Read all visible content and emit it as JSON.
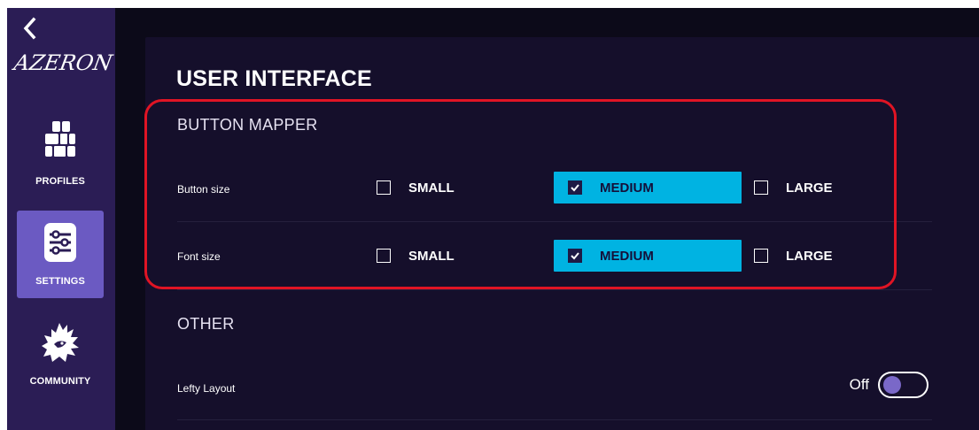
{
  "app": {
    "brand": "AZERON"
  },
  "sidebar": {
    "back_icon": "chevron-left-icon",
    "items": [
      {
        "label": "PROFILES",
        "icon": "grid-icon",
        "active": false
      },
      {
        "label": "SETTINGS",
        "icon": "sliders-icon",
        "active": true
      },
      {
        "label": "COMMUNITY",
        "icon": "dragon-icon",
        "active": false
      }
    ]
  },
  "main": {
    "title": "USER INTERFACE",
    "button_mapper": {
      "title": "BUTTON MAPPER",
      "rows": [
        {
          "label": "Button size",
          "options": [
            {
              "label": "SMALL",
              "checked": false
            },
            {
              "label": "MEDIUM",
              "checked": true
            },
            {
              "label": "LARGE",
              "checked": false
            }
          ]
        },
        {
          "label": "Font size",
          "options": [
            {
              "label": "SMALL",
              "checked": false
            },
            {
              "label": "MEDIUM",
              "checked": true
            },
            {
              "label": "LARGE",
              "checked": false
            }
          ]
        }
      ]
    },
    "other": {
      "title": "OTHER",
      "lefty_layout": {
        "label": "Lefty Layout",
        "state_text": "Off",
        "enabled": false
      }
    }
  },
  "colors": {
    "sidebar_bg": "#2b1d55",
    "active_nav": "#6b5ac2",
    "selected_option": "#00b3e2",
    "highlight": "#e01424",
    "toggle_knob": "#7a68c8"
  }
}
